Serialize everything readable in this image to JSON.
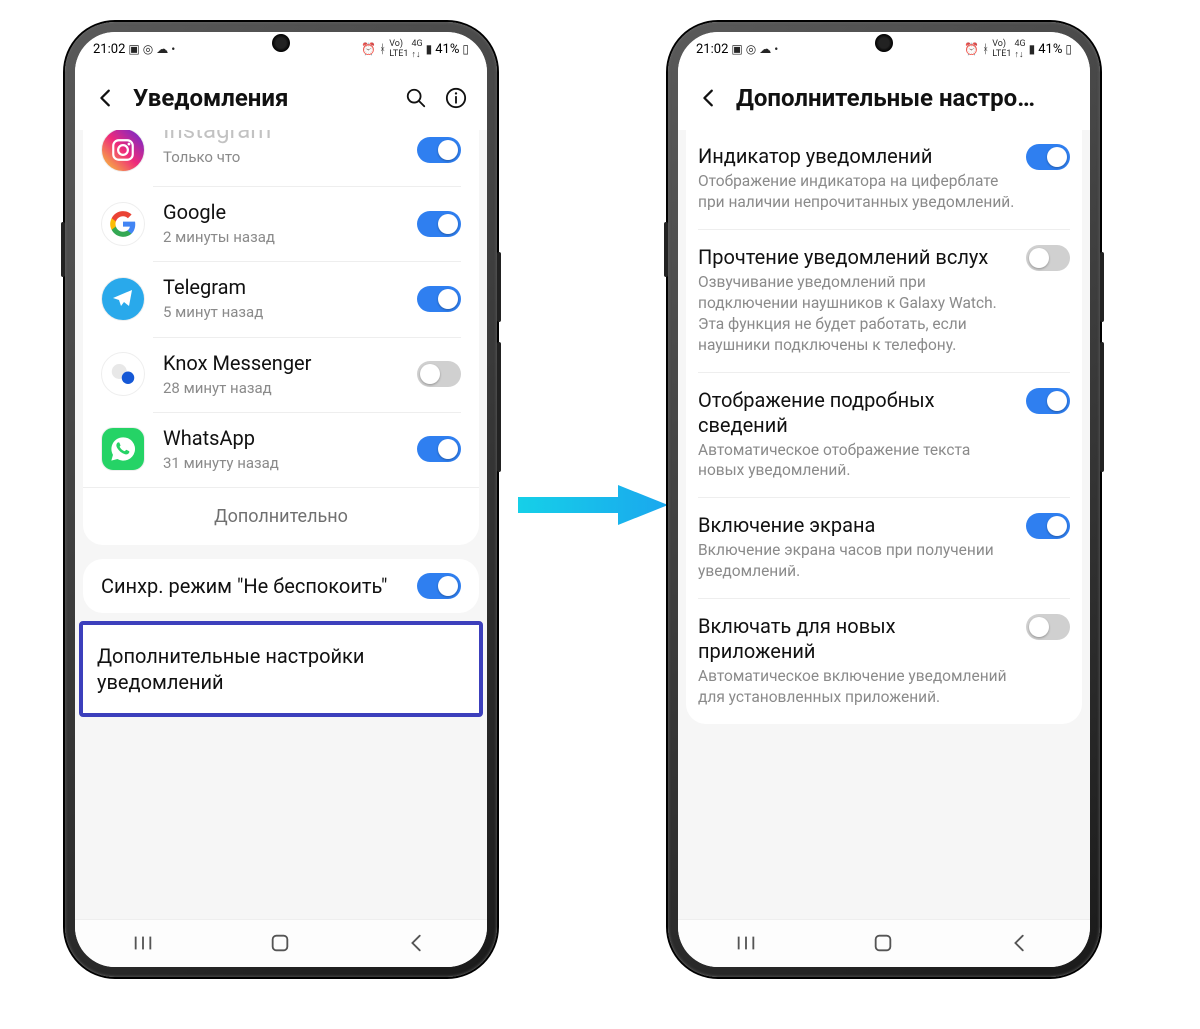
{
  "statusbar": {
    "time": "21:02",
    "battery": "41%"
  },
  "phone1": {
    "title": "Уведомления",
    "apps": [
      {
        "name": "Instagram",
        "sub": "Только что",
        "on": true,
        "icon": "instagram"
      },
      {
        "name": "Google",
        "sub": "2 минуты назад",
        "on": true,
        "icon": "google"
      },
      {
        "name": "Telegram",
        "sub": "5 минут назад",
        "on": true,
        "icon": "telegram"
      },
      {
        "name": "Knox Messenger",
        "sub": "28 минут назад",
        "on": false,
        "icon": "knox"
      },
      {
        "name": "WhatsApp",
        "sub": "31 минуту назад",
        "on": true,
        "icon": "whatsapp"
      }
    ],
    "more": "Дополнительно",
    "dnd": {
      "title": "Синхр. режим \"Не беспокоить\"",
      "on": true
    },
    "advanced": "Дополнительные настройки уведомлений"
  },
  "phone2": {
    "title": "Дополнительные настро…",
    "settings": [
      {
        "title": "Индикатор уведомлений",
        "sub": "Отображение индикатора на циферблате при наличии непрочитанных уведомлений.",
        "on": true
      },
      {
        "title": "Прочтение уведомлений вслух",
        "sub": "Озвучивание уведомлений при подключении наушников к Galaxy Watch. Эта функция не будет работать, если наушники подключены к телефону.",
        "on": false
      },
      {
        "title": "Отображение подробных сведений",
        "sub": "Автоматическое отображение текста новых уведомлений.",
        "on": true
      },
      {
        "title": "Включение экрана",
        "sub": "Включение экрана часов при получении уведомлений.",
        "on": true
      },
      {
        "title": "Включать для новых приложений",
        "sub": "Автоматическое включение уведомлений для установленных приложений.",
        "on": false
      }
    ]
  }
}
